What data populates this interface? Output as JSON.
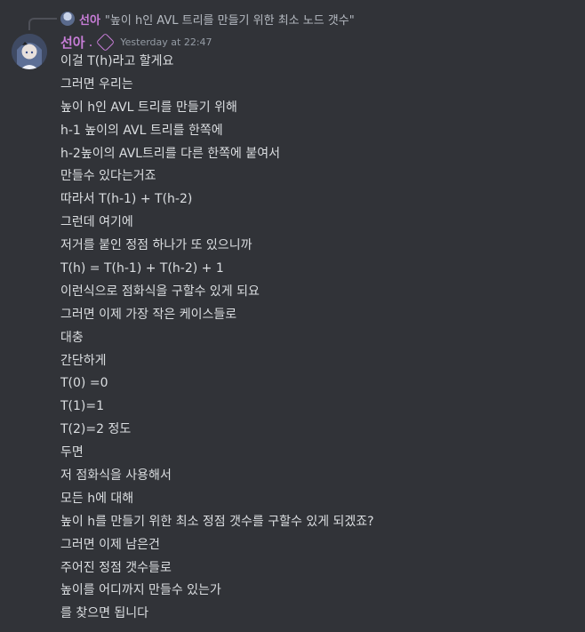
{
  "reply": {
    "username": "선아",
    "text": "\"높이 h인 AVL 트리를 만들기 위한 최소 노드 갯수\""
  },
  "author": {
    "username": "선아",
    "separator": ".",
    "timestamp": "Yesterday at 22:47"
  },
  "message_lines": [
    "이걸 T(h)라고 할게요",
    "그러면 우리는",
    "높이 h인 AVL 트리를 만들기 위해",
    "h-1 높이의 AVL 트리를 한쪽에",
    "h-2높이의 AVL트리를 다른 한쪽에 붙여서",
    "만들수 있다는거죠",
    "따라서 T(h-1) + T(h-2)",
    "그런데 여기에",
    "저거를 붙인 정점 하나가 또 있으니까",
    "T(h) = T(h-1) + T(h-2) + 1",
    "이런식으로 점화식을 구할수 있게 되요",
    "그러면 이제 가장 작은 케이스들로",
    "대충",
    "간단하게",
    "T(0) =0",
    "T(1)=1",
    "T(2)=2 정도",
    "두면",
    "저 점화식을 사용해서",
    "모든 h에 대해",
    "높이 h를 만들기 위한 최소 정점 갯수를 구할수 있게 되겠죠?",
    "그러면 이제 남은건",
    "주어진 정점 갯수들로",
    "높이를 어디까지 만들수 있는가",
    "를 찾으면 됩니다"
  ],
  "colors": {
    "background": "#313338",
    "username": "#c77dd7",
    "text": "#dbdee1",
    "muted": "#949ba4"
  }
}
